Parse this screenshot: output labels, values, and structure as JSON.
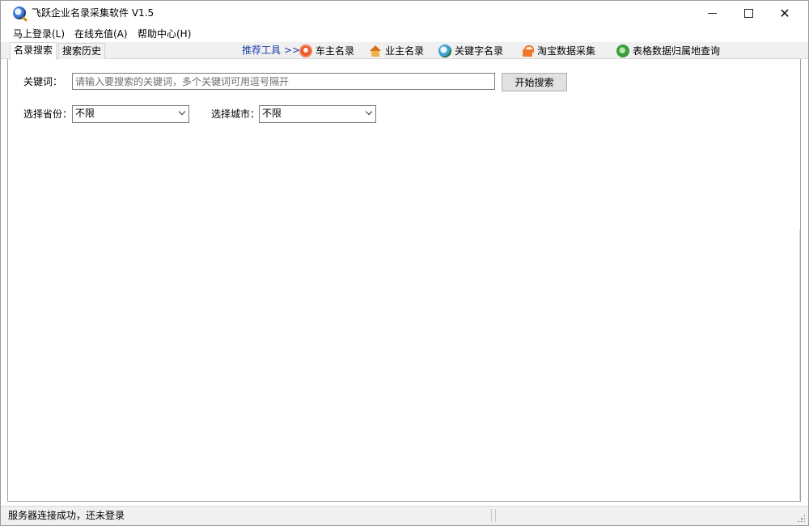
{
  "window": {
    "title": "飞跃企业名录采集软件 V1.5",
    "icon": "magnifier-globe-icon"
  },
  "menu": [
    {
      "label": "马上登录(L)"
    },
    {
      "label": "在线充值(A)"
    },
    {
      "label": "帮助中心(H)"
    }
  ],
  "tabs": [
    {
      "label": "名录搜索",
      "active": true
    },
    {
      "label": "搜索历史",
      "active": false
    }
  ],
  "recommend": {
    "label": "推荐工具 >>",
    "tools": [
      {
        "label": "车主名录",
        "icon": "car-owner-icon"
      },
      {
        "label": "业主名录",
        "icon": "house-icon"
      },
      {
        "label": "关键字名录",
        "icon": "keyword-globe-icon"
      },
      {
        "label": "淘宝数据采集",
        "icon": "shopping-bag-icon"
      },
      {
        "label": "表格数据归属地查询",
        "icon": "globe-icon"
      }
    ]
  },
  "search": {
    "keyword_label": "关键词：",
    "keyword_value": "",
    "keyword_placeholder": "请输入要搜索的关键词，多个关键词可用逗号隔开",
    "start_button": "开始搜索",
    "province_label": "选择省份：",
    "province_value": "不限",
    "city_label": "选择城市：",
    "city_value": "不限"
  },
  "status": {
    "text": "服务器连接成功，还未登录"
  },
  "colors": {
    "recommend_text": "#1a3fa8",
    "chrome_bg": "#f0f0f0"
  }
}
